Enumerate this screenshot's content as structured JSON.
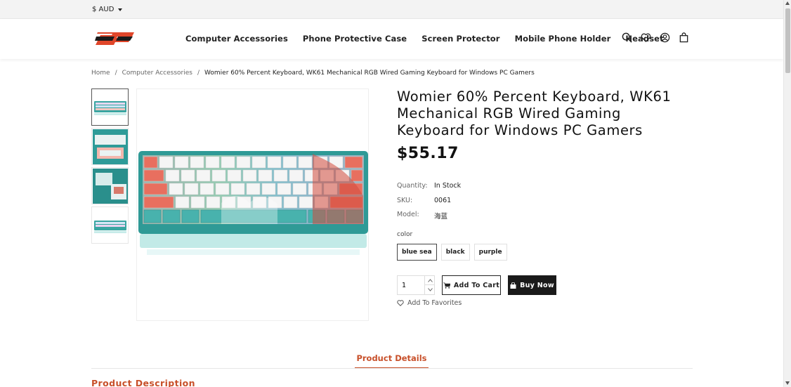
{
  "currency": {
    "label": "$ AUD"
  },
  "logo": {
    "text": "BP",
    "color": "#e0462a"
  },
  "nav": {
    "items": [
      {
        "label": "Computer Accessories"
      },
      {
        "label": "Phone Protective Case"
      },
      {
        "label": "Screen Protector"
      },
      {
        "label": "Mobile Phone Holder"
      },
      {
        "label": "Headset"
      }
    ]
  },
  "header_icons": [
    "search-icon",
    "heart-icon",
    "account-icon",
    "bag-icon"
  ],
  "breadcrumb": {
    "home": "Home",
    "category": "Computer Accessories",
    "current": "Womier 60% Percent Keyboard, WK61 Mechanical RGB Wired Gaming Keyboard for Windows PC Gamers",
    "separator": "/"
  },
  "product": {
    "title": "Womier 60% Percent Keyboard, WK61 Mechanical RGB Wired Gaming Keyboard for Windows PC Gamers",
    "price": "$55.17",
    "quantity_label": "Quantity:",
    "stock": "In Stock",
    "sku_label": "SKU:",
    "sku": "0061",
    "model_label": "Model:",
    "model": "海蓝",
    "color_label": "color",
    "color_options": [
      {
        "label": "blue sea",
        "selected": true
      },
      {
        "label": "black",
        "selected": false
      },
      {
        "label": "purple",
        "selected": false
      }
    ],
    "quantity_value": "1",
    "add_to_cart": "Add To Cart",
    "buy_now": "Buy Now",
    "add_to_favorites": "Add To Favorites"
  },
  "tabs": {
    "active": "Product Details"
  },
  "description_heading": "Product Description",
  "colors": {
    "accent": "#c8502a",
    "in_stock": "#5cb85c",
    "teal": "#3aa6a2"
  }
}
